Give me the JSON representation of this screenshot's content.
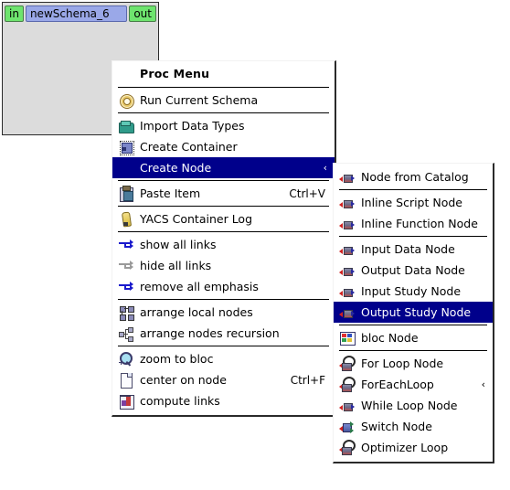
{
  "canvas": {
    "node": {
      "in_port": "in",
      "title": "newSchema_6",
      "out_port": "out"
    }
  },
  "proc_menu": {
    "title": "Proc Menu",
    "groups": [
      {
        "items": [
          {
            "label": "Run Current Schema",
            "icon": "gear-icon",
            "accel": "",
            "submenu": false
          }
        ]
      },
      {
        "items": [
          {
            "label": "Import Data Types",
            "icon": "folder-icon",
            "accel": "",
            "submenu": false
          },
          {
            "label": "Create Container",
            "icon": "container-icon",
            "accel": "",
            "submenu": false
          },
          {
            "label": "Create Node",
            "icon": "none-icon",
            "accel": "",
            "submenu": true,
            "selected": true
          }
        ]
      },
      {
        "items": [
          {
            "label": "Paste Item",
            "icon": "clipboard-icon",
            "accel": "Ctrl+V",
            "submenu": false
          }
        ]
      },
      {
        "items": [
          {
            "label": "YACS Container Log",
            "icon": "pencil-icon",
            "accel": "",
            "submenu": false
          }
        ]
      },
      {
        "items": [
          {
            "label": "show all links",
            "icon": "link-arrow-icon",
            "accel": "",
            "submenu": false
          },
          {
            "label": "hide all links",
            "icon": "link-arrow-grey-icon",
            "accel": "",
            "submenu": false
          },
          {
            "label": "remove all emphasis",
            "icon": "link-arrow-icon",
            "accel": "",
            "submenu": false
          }
        ]
      },
      {
        "items": [
          {
            "label": "arrange local nodes",
            "icon": "grid-squares-icon",
            "accel": "",
            "submenu": false
          },
          {
            "label": "arrange nodes recursion",
            "icon": "tree-nodes-icon",
            "accel": "",
            "submenu": false
          }
        ]
      },
      {
        "items": [
          {
            "label": "zoom to bloc",
            "icon": "magnifier-icon",
            "accel": "",
            "submenu": false
          },
          {
            "label": "center on node",
            "icon": "page-icon",
            "accel": "Ctrl+F",
            "submenu": false
          },
          {
            "label": "compute links",
            "icon": "chart-icon",
            "accel": "",
            "submenu": false
          }
        ]
      }
    ]
  },
  "create_node_submenu": {
    "groups": [
      {
        "items": [
          {
            "label": "Node from Catalog",
            "icon": "node-icon",
            "submenu": false
          }
        ]
      },
      {
        "items": [
          {
            "label": "Inline Script Node",
            "icon": "node-icon",
            "submenu": false
          },
          {
            "label": "Inline Function Node",
            "icon": "node-icon",
            "submenu": false
          }
        ]
      },
      {
        "items": [
          {
            "label": "Input Data Node",
            "icon": "node-icon",
            "submenu": false
          },
          {
            "label": "Output Data Node",
            "icon": "node-icon",
            "submenu": false
          },
          {
            "label": "Input Study Node",
            "icon": "node-icon",
            "submenu": false
          },
          {
            "label": "Output Study Node",
            "icon": "node-icon",
            "submenu": false,
            "selected": true
          }
        ]
      },
      {
        "items": [
          {
            "label": "bloc Node",
            "icon": "bloc-icon",
            "submenu": false
          }
        ]
      },
      {
        "items": [
          {
            "label": "For Loop Node",
            "icon": "loop-icon",
            "submenu": false
          },
          {
            "label": "ForEachLoop",
            "icon": "loop-icon",
            "submenu": true
          },
          {
            "label": "While Loop Node",
            "icon": "node-icon",
            "submenu": false
          },
          {
            "label": "Switch Node",
            "icon": "switch-icon",
            "submenu": false
          },
          {
            "label": "Optimizer Loop",
            "icon": "loop-icon",
            "submenu": false
          }
        ]
      }
    ]
  },
  "submenu_marker": "‹",
  "colors": {
    "selection": "#00008B",
    "selection_text": "#FFFFFF",
    "menu_background": "#FFFFFF",
    "canvas_node_body": "#DCDCDC",
    "port_green": "#6EE46E",
    "title_blue": "#9AA8E8"
  }
}
